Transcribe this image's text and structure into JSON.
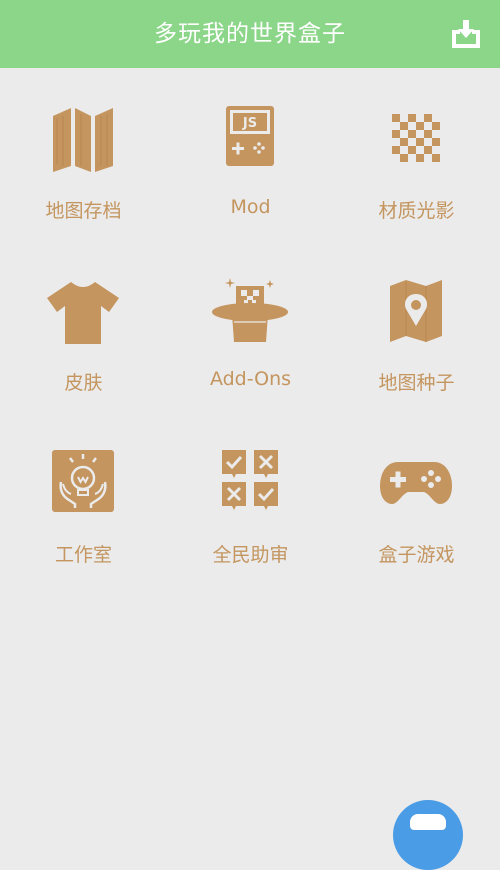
{
  "header": {
    "title": "多玩我的世界盒子",
    "download_icon": "download-box-icon"
  },
  "colors": {
    "header_bg": "#8cd68a",
    "accent": "#c4955f",
    "page_bg": "#ebebeb",
    "float_button": "#4a9ce6"
  },
  "grid": {
    "items": [
      {
        "label": "地图存档",
        "icon": "folded-map-icon"
      },
      {
        "label": "Mod",
        "icon": "js-gameboy-icon"
      },
      {
        "label": "材质光影",
        "icon": "checkerboard-icon"
      },
      {
        "label": "皮肤",
        "icon": "shirt-icon"
      },
      {
        "label": "Add-Ons",
        "icon": "magic-hat-creeper-icon"
      },
      {
        "label": "地图种子",
        "icon": "map-pin-icon"
      },
      {
        "label": "工作室",
        "icon": "lightbulb-hands-icon"
      },
      {
        "label": "全民助审",
        "icon": "review-check-icon"
      },
      {
        "label": "盒子游戏",
        "icon": "gamepad-icon"
      }
    ]
  },
  "float_button": {
    "icon": "chat-face-icon"
  }
}
